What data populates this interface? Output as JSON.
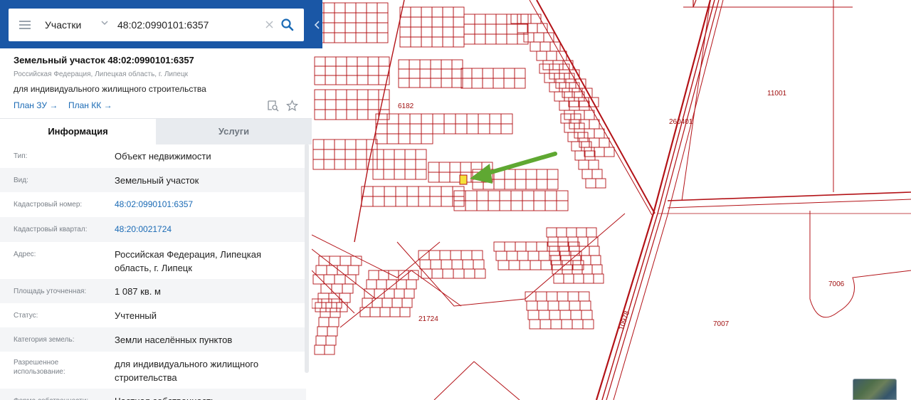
{
  "search": {
    "type_label": "Участки",
    "query": "48:02:0990101:6357"
  },
  "parcel": {
    "title": "Земельный участок 48:02:0990101:6357",
    "region": "Российская Федерация, Липецкая область, г. Липецк",
    "purpose": "для индивидуального жилищного строительства",
    "plan_zu_label": "План ЗУ →",
    "plan_kk_label": "План КК →"
  },
  "tabs": {
    "info_label": "Информация",
    "services_label": "Услуги"
  },
  "info": {
    "rows": [
      {
        "key": "Тип:",
        "value": "Объект недвижимости"
      },
      {
        "key": "Вид:",
        "value": "Земельный участок"
      },
      {
        "key": "Кадастровый номер:",
        "value": "48:02:0990101:6357"
      },
      {
        "key": "Кадастровый квартал:",
        "value": "48:20:0021724"
      },
      {
        "key": "Адрес:",
        "value": "Российская Федерация, Липецкая область, г. Липецк"
      },
      {
        "key": "Площадь уточненная:",
        "value": "1 087 кв. м"
      },
      {
        "key": "Статус:",
        "value": "Учтенный"
      },
      {
        "key": "Категория земель:",
        "value": "Земли населённых пунктов"
      },
      {
        "key": "Разрешенное использование:",
        "value": "для индивидуального жилищного строительства"
      },
      {
        "key": "Форма собственности:",
        "value": "Частная собственность"
      }
    ]
  },
  "map": {
    "labels": {
      "l6182": "6182",
      "l260401": "260401",
      "l11001": "11001",
      "l7006": "7006",
      "l7007": "7007",
      "l21724": "21724",
      "l10978": "10978"
    },
    "colors": {
      "parcel_line": "#b31217",
      "selected_parcel": "#f5e13a",
      "arrow": "#5fa832"
    }
  },
  "colors": {
    "header_blue": "#1a57a6",
    "link_blue": "#1a6ab5"
  },
  "icons": {
    "menu": "hamburger-icon",
    "dropdown": "chevron-down-icon",
    "clear": "close-icon",
    "search": "search-icon",
    "collapse": "chevron-left-icon",
    "find_on_map": "find-on-map-icon",
    "favorite": "star-icon"
  }
}
